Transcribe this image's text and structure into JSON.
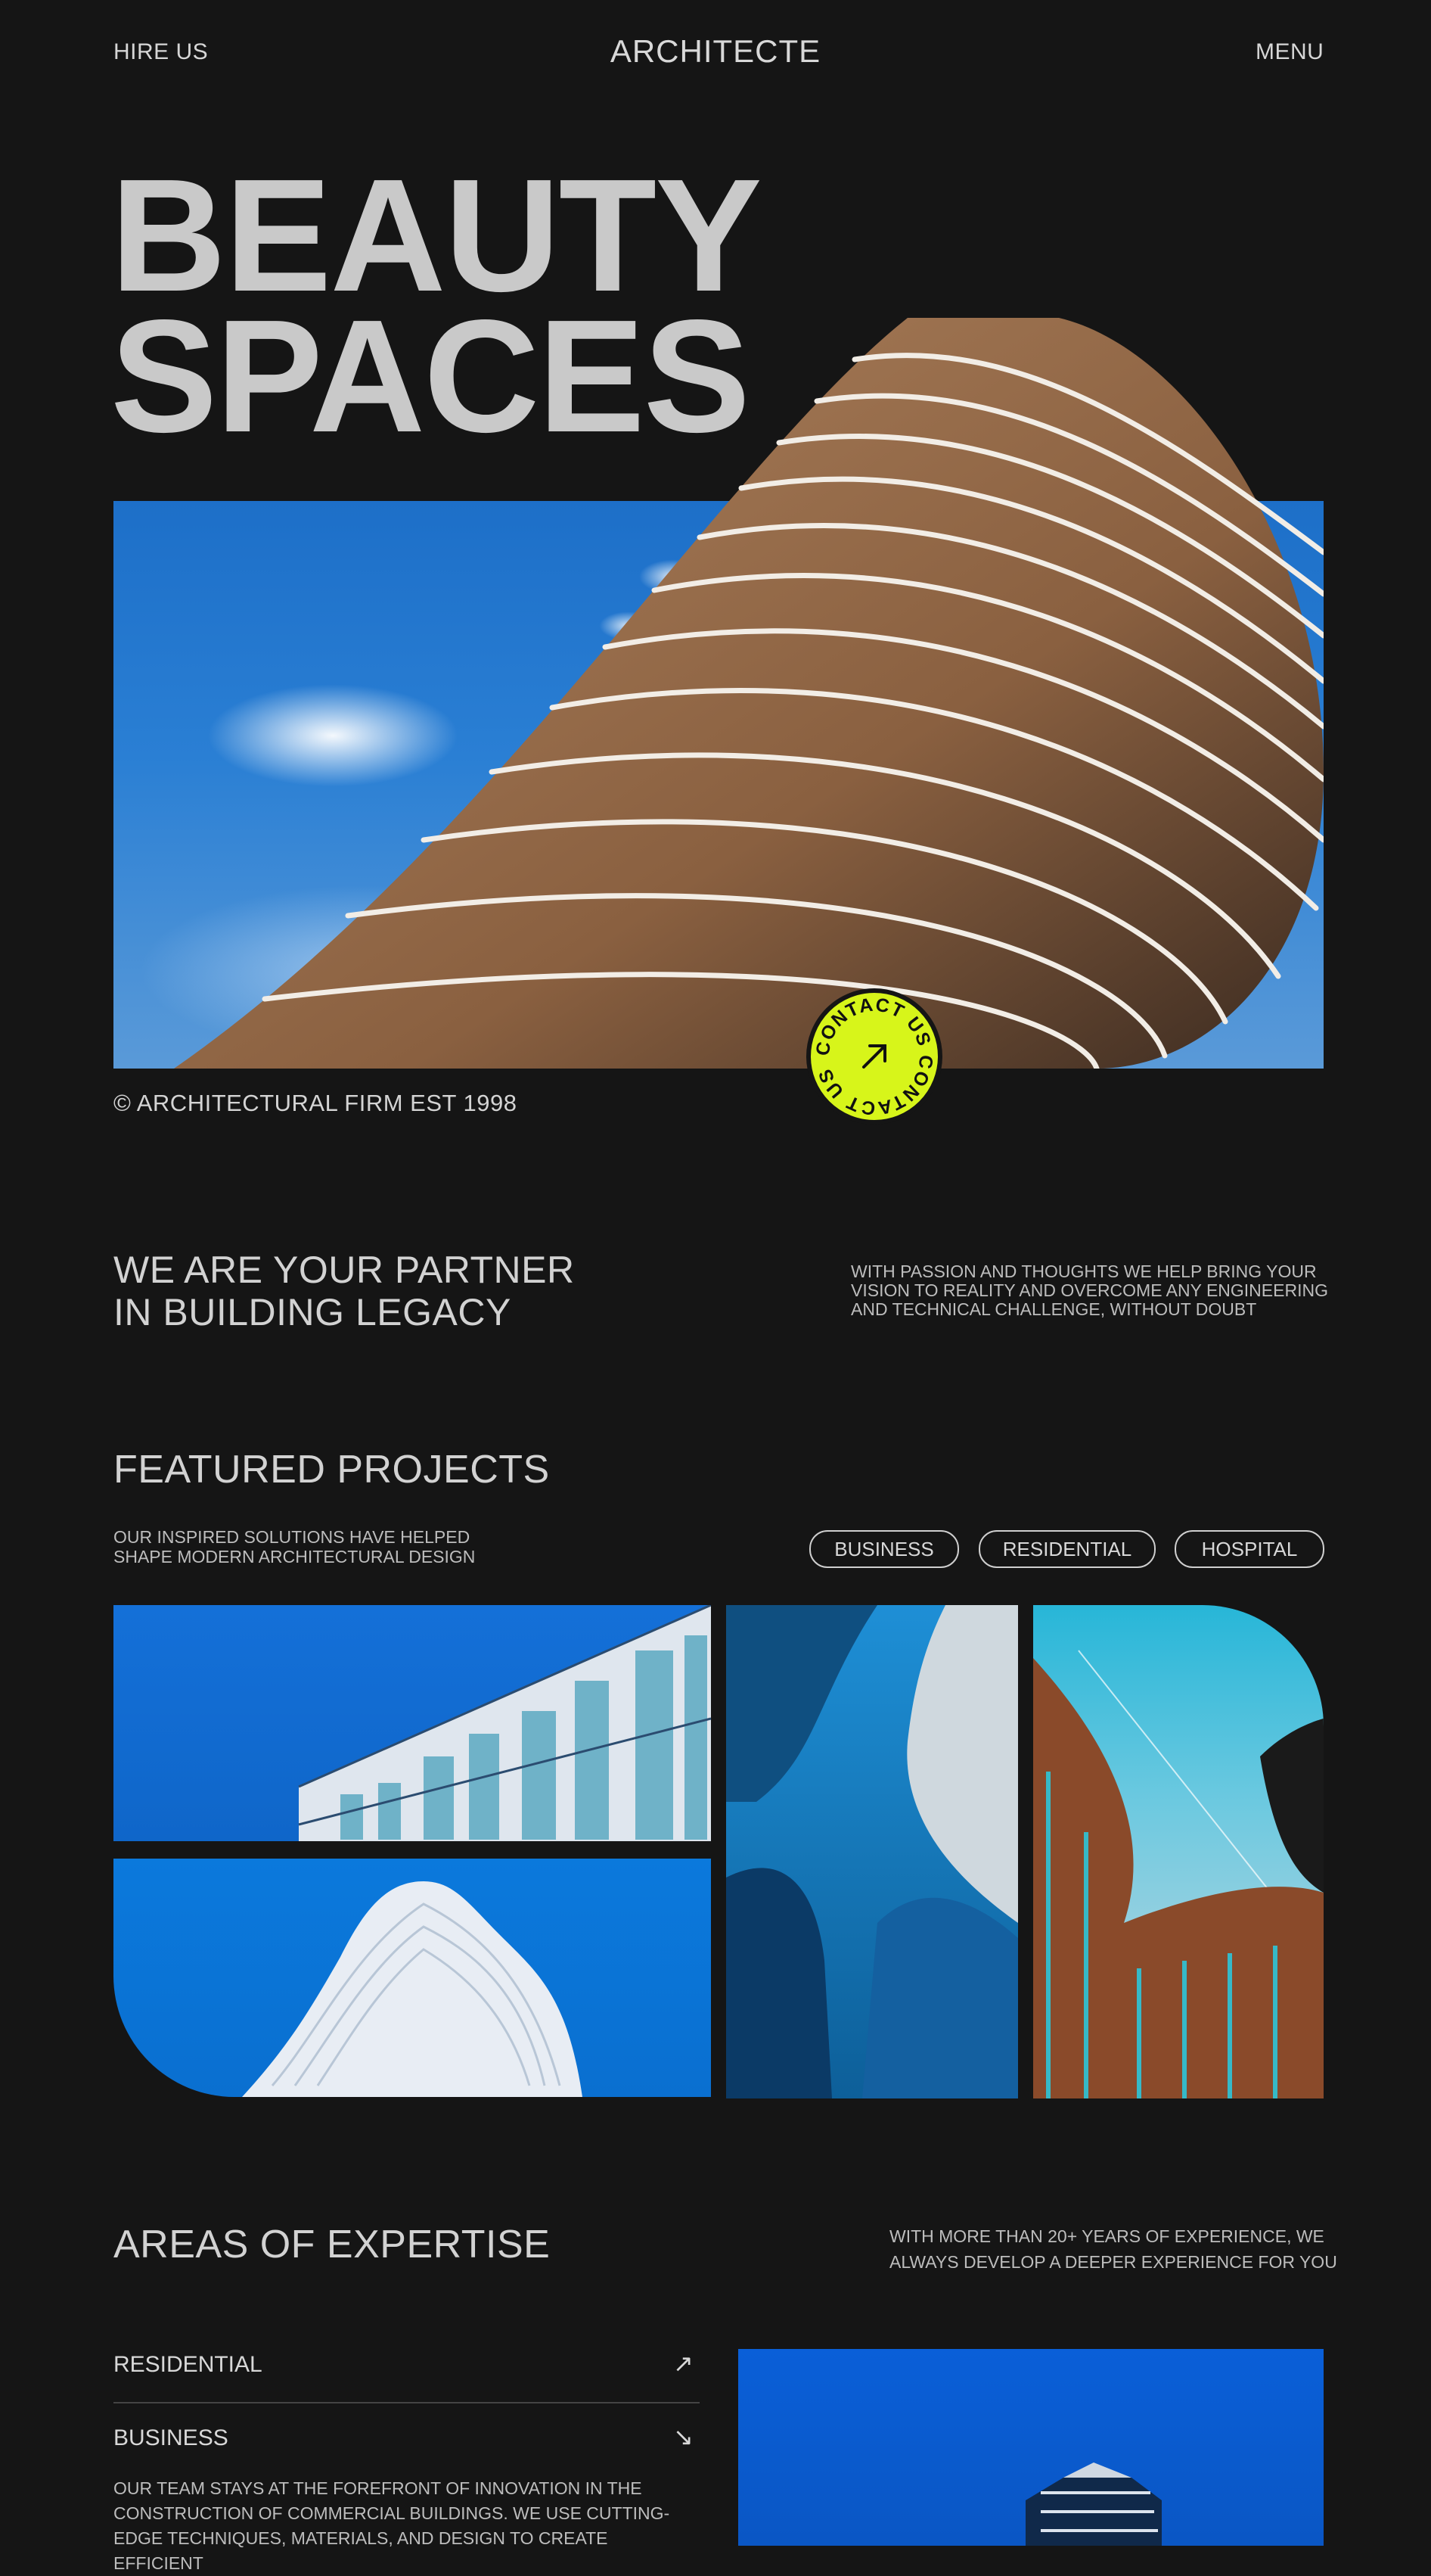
{
  "header": {
    "hire_label": "HIRE US",
    "brand": "ARCHITECTE",
    "menu_label": "MENU"
  },
  "hero": {
    "title_line1": "BEAUTY",
    "title_line2": "SPACES",
    "copyright": "© ARCHITECTURAL FIRM EST 1998",
    "contact_badge_text": "CONTACT US CONTACT US ",
    "contact_badge_icon": "arrow-up-right-icon"
  },
  "partner": {
    "title_line1": "WE ARE YOUR PARTNER",
    "title_line2": "IN BUILDING LEGACY",
    "text_lines": [
      "WITH PASSION AND THOUGHTS WE HELP BRING YOUR",
      "VISION TO REALITY AND OVERCOME ANY ENGINEERING",
      "AND TECHNICAL CHALLENGE, WITHOUT DOUBT"
    ]
  },
  "featured": {
    "title": "FEATURED PROJECTS",
    "sub_lines": [
      "OUR INSPIRED SOLUTIONS HAVE HELPED",
      "SHAPE MODERN ARCHITECTURAL DESIGN"
    ],
    "filters": [
      "BUSINESS",
      "RESIDENTIAL",
      "HOSPITAL"
    ]
  },
  "expertise": {
    "title": "AREAS OF EXPERTISE",
    "text_lines": [
      "WITH MORE THAN 20+ YEARS OF EXPERIENCE, WE",
      "ALWAYS DEVELOP A DEEPER EXPERIENCE FOR YOU"
    ],
    "items": [
      {
        "label": "RESIDENTIAL",
        "arrow": "↗",
        "icon": "arrow-up-right-icon"
      },
      {
        "label": "BUSINESS",
        "arrow": "↘",
        "icon": "arrow-down-right-icon"
      }
    ],
    "desc_lines": [
      "OUR TEAM STAYS AT THE FOREFRONT OF INNOVATION IN THE",
      "CONSTRUCTION OF COMMERCIAL BUILDINGS. WE USE CUTTING-",
      "EDGE TECHNIQUES, MATERIALS, AND DESIGN TO CREATE EFFICIENT"
    ]
  },
  "colors": {
    "background": "#151515",
    "text": "#cfcfcf",
    "accent": "#d7f51a"
  }
}
